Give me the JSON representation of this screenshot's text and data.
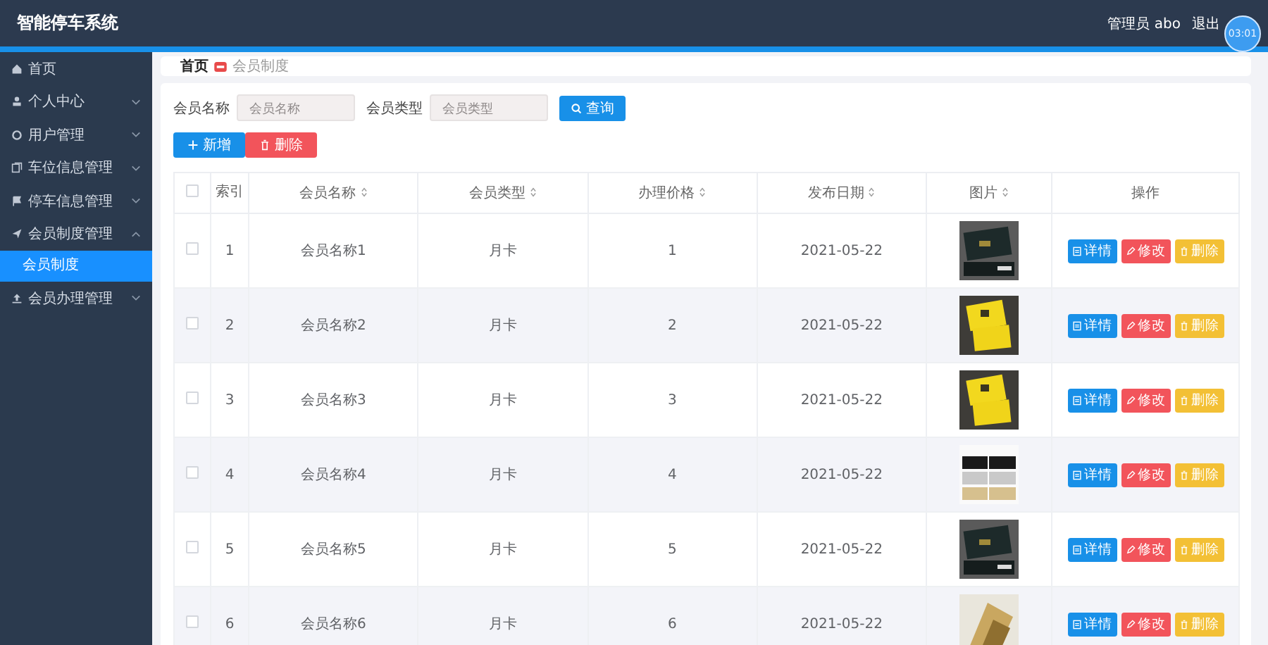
{
  "header": {
    "title": "智能停车系统",
    "user": "管理员 abo",
    "logout": "退出",
    "timer": "03:01"
  },
  "sidebar": {
    "items": [
      {
        "label": "首页",
        "kind": "link"
      },
      {
        "label": "个人中心",
        "kind": "menu",
        "expanded": false
      },
      {
        "label": "用户管理",
        "kind": "menu",
        "expanded": false
      },
      {
        "label": "车位信息管理",
        "kind": "menu",
        "expanded": false
      },
      {
        "label": "停车信息管理",
        "kind": "menu",
        "expanded": false
      },
      {
        "label": "会员制度管理",
        "kind": "menu",
        "expanded": true,
        "children": [
          {
            "label": "会员制度",
            "selected": true
          }
        ]
      },
      {
        "label": "会员办理管理",
        "kind": "menu",
        "expanded": false
      }
    ]
  },
  "breadcrumb": [
    {
      "label": "首页",
      "current": false
    },
    {
      "label": "会员制度",
      "current": true
    }
  ],
  "search": {
    "fields": [
      {
        "label": "会员名称",
        "placeholder": "会员名称"
      },
      {
        "label": "会员类型",
        "placeholder": "会员类型"
      }
    ],
    "button": "查询"
  },
  "toolbar": [
    {
      "label": "新增",
      "kind": "add"
    },
    {
      "label": "删除",
      "kind": "delete"
    }
  ],
  "table": {
    "select_all": false,
    "columns": [
      {
        "label": "索引",
        "sortable": false
      },
      {
        "label": "会员名称",
        "sortable": true
      },
      {
        "label": "会员类型",
        "sortable": true
      },
      {
        "label": "办理价格",
        "sortable": true
      },
      {
        "label": "发布日期",
        "sortable": true
      },
      {
        "label": "图片",
        "sortable": true
      },
      {
        "label": "操作",
        "sortable": false
      }
    ],
    "rows": [
      {
        "checked": false,
        "index": "1",
        "name": "会员名称1",
        "type": "月卡",
        "price": "1",
        "date": "2021-05-22",
        "actions": [
          "详情",
          "修改",
          "删除"
        ]
      },
      {
        "checked": false,
        "index": "2",
        "name": "会员名称2",
        "type": "月卡",
        "price": "2",
        "date": "2021-05-22",
        "actions": [
          "详情",
          "修改",
          "删除"
        ]
      },
      {
        "checked": false,
        "index": "3",
        "name": "会员名称3",
        "type": "月卡",
        "price": "3",
        "date": "2021-05-22",
        "actions": [
          "详情",
          "修改",
          "删除"
        ]
      },
      {
        "checked": false,
        "index": "4",
        "name": "会员名称4",
        "type": "月卡",
        "price": "4",
        "date": "2021-05-22",
        "actions": [
          "详情",
          "修改",
          "删除"
        ]
      },
      {
        "checked": false,
        "index": "5",
        "name": "会员名称5",
        "type": "月卡",
        "price": "5",
        "date": "2021-05-22",
        "actions": [
          "详情",
          "修改",
          "删除"
        ]
      },
      {
        "checked": false,
        "index": "6",
        "name": "会员名称6",
        "type": "月卡",
        "price": "6",
        "date": "2021-05-22",
        "actions": [
          "详情",
          "修改",
          "删除"
        ]
      }
    ]
  }
}
